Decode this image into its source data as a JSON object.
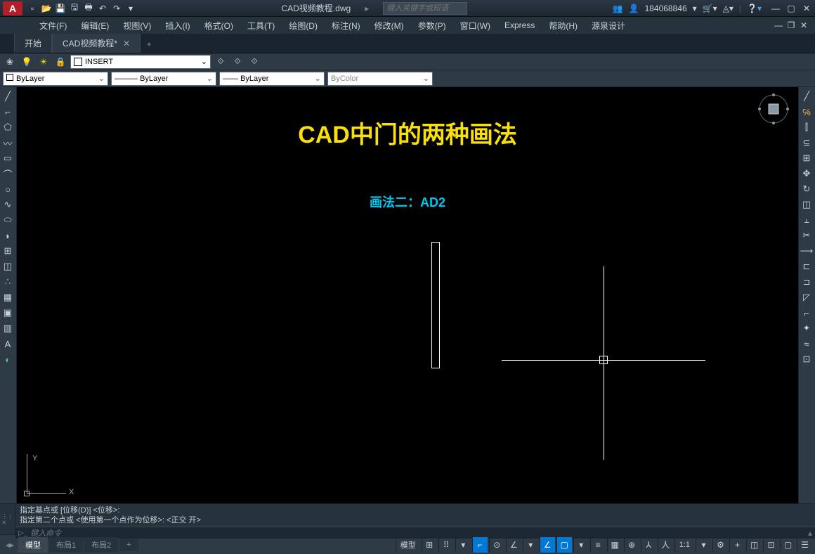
{
  "title": "CAD视频教程.dwg",
  "search_placeholder": "键入关键字或短语",
  "user": "184068846",
  "menu": [
    "文件(F)",
    "编辑(E)",
    "视图(V)",
    "插入(I)",
    "格式(O)",
    "工具(T)",
    "绘图(D)",
    "标注(N)",
    "修改(M)",
    "参数(P)",
    "窗口(W)",
    "Express",
    "帮助(H)",
    "源泉设计"
  ],
  "tabs": [
    {
      "label": "开始",
      "close": false
    },
    {
      "label": "CAD视频教程*",
      "close": true
    }
  ],
  "layer_name": "INSERT",
  "bylayer": "ByLayer",
  "bycolor": "ByColor",
  "canvas_title": "CAD中门的两种画法",
  "canvas_sub": "画法二：AD2",
  "ucs_x": "X",
  "ucs_y": "Y",
  "cmd_hist1": "指定基点或 [位移(D)] <位移>:",
  "cmd_hist2": "指定第二个点或 <使用第一个点作为位移>:   <正交 开>",
  "cmd_placeholder": "键入命令",
  "model_tabs": [
    "模型",
    "布局1",
    "布局2"
  ],
  "scale": "1:1",
  "status_model": "模型"
}
